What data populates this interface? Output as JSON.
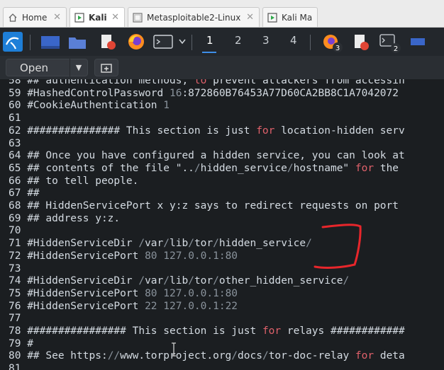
{
  "vm_tabs": [
    {
      "label": "Home",
      "icon": "home-icon",
      "active": false
    },
    {
      "label": "Kali",
      "icon": "vm-running-icon",
      "active": true
    },
    {
      "label": "Metasploitable2-Linux",
      "icon": "vm-icon",
      "active": false
    },
    {
      "label": "Kali Main",
      "icon": "vm-running-icon",
      "active": false
    }
  ],
  "panel": {
    "workspaces": [
      "1",
      "2",
      "3",
      "4"
    ],
    "current_workspace": "1",
    "badges": {
      "firefox_windows": "3",
      "terminal_windows": "2"
    },
    "icons": [
      "kali-menu-icon",
      "show-desktop-icon",
      "file-manager-icon",
      "text-editor-icon",
      "firefox-icon",
      "terminal-icon",
      "workspace-1",
      "workspace-2",
      "workspace-3",
      "workspace-4",
      "firefox-windows-icon",
      "text-editor-window-icon",
      "terminal-window-icon",
      "blue-window-icon"
    ]
  },
  "toolbar": {
    "open_label": "Open",
    "open_arrow": "▼",
    "new_tab_icon": "new-tab-icon"
  },
  "editor": {
    "lines": [
      {
        "num": "58",
        "text": " ## authentication methods, to prevent attackers from accessin"
      },
      {
        "num": "59",
        "text": " #HashedControlPassword 16:872860B76453A77D60CA2BB8C1A7042072"
      },
      {
        "num": "60",
        "text": " #CookieAuthentication 1"
      },
      {
        "num": "61",
        "text": ""
      },
      {
        "num": "62",
        "text": " ############### This section is just for location-hidden serv"
      },
      {
        "num": "63",
        "text": ""
      },
      {
        "num": "64",
        "text": " ## Once you have configured a hidden service, you can look at"
      },
      {
        "num": "65",
        "text": " ## contents of the file \"../hidden_service/hostname\" for the"
      },
      {
        "num": "66",
        "text": " ## to tell people."
      },
      {
        "num": "67",
        "text": " ##"
      },
      {
        "num": "68",
        "text": " ## HiddenServicePort x y:z says to redirect requests on port"
      },
      {
        "num": "69",
        "text": " ## address y:z."
      },
      {
        "num": "70",
        "text": ""
      },
      {
        "num": "71",
        "text": " #HiddenServiceDir /var/lib/tor/hidden_service/"
      },
      {
        "num": "72",
        "text": " #HiddenServicePort 80 127.0.0.1:80"
      },
      {
        "num": "73",
        "text": ""
      },
      {
        "num": "74",
        "text": " #HiddenServiceDir /var/lib/tor/other_hidden_service/"
      },
      {
        "num": "75",
        "text": " #HiddenServicePort 80 127.0.0.1:80"
      },
      {
        "num": "76",
        "text": " #HiddenServicePort 22 127.0.0.1:22"
      },
      {
        "num": "77",
        "text": ""
      },
      {
        "num": "78",
        "text": " ################ This section is just for relays ############"
      },
      {
        "num": "79",
        "text": " #"
      },
      {
        "num": "80",
        "text": " ## See https://www.torproject.org/docs/tor-doc-relay for deta"
      },
      {
        "num": "81",
        "text": ""
      }
    ]
  },
  "colors": {
    "keyword": "#e0616b",
    "dim": "#8a939c",
    "text": "#d4dbe2",
    "annotation": "#e8262b",
    "accent": "#3e8ee8"
  }
}
